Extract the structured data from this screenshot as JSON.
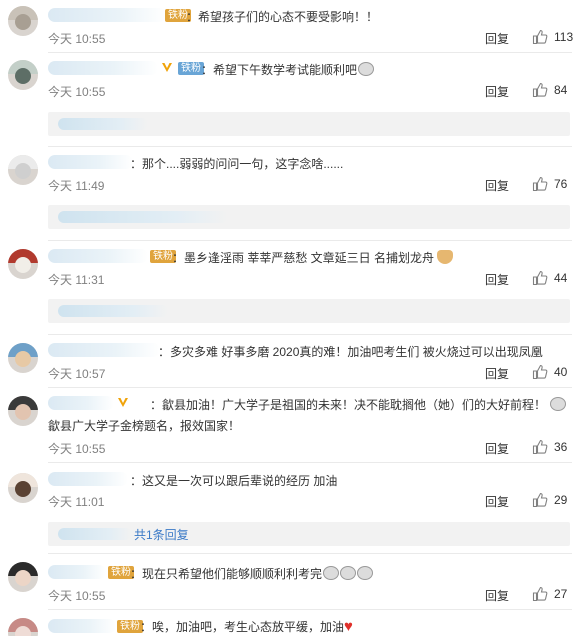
{
  "actions": {
    "reply_label": "回复"
  },
  "comments": [
    {
      "badge": "铁粉",
      "text": "：希望孩子们的心态不要受影响！！",
      "time": "今天 10:55",
      "likes": "113"
    },
    {
      "badge": "铁粉",
      "text": "：希望下午数学考试能顺利吧",
      "time": "今天 10:55",
      "likes": "84"
    },
    {
      "text": "：那个....弱弱的问问一句，这字念啥......",
      "time": "今天 11:49",
      "likes": "76"
    },
    {
      "badge": "铁粉",
      "text": "：墨乡逢淫雨 莘莘严慈愁 文章延三日 名捕划龙舟",
      "time": "今天 11:31",
      "likes": "44"
    },
    {
      "text": "：多灾多难 好事多磨 2020真的难！加油吧考生们 被火烧过可以出现凤凰",
      "time": "今天 10:57",
      "likes": "40"
    },
    {
      "text": "：歙县加油！广大学子是祖国的未来！决不能耽搁他（她）们的大好前程！",
      "text2": "歙县广大学子金榜题名，报效国家！",
      "time": "今天 10:55",
      "likes": "36"
    },
    {
      "text": "：这又是一次可以跟后辈说的经历 加油",
      "time": "今天 11:01",
      "likes": "29",
      "sub_reply": "共1条回复"
    },
    {
      "badge": "铁粉",
      "text": "：现在只希望他们能够顺顺利利考完",
      "time": "今天 10:55",
      "likes": "27"
    },
    {
      "badge": "铁粉",
      "text": "：唉，加油吧，考生心态放平缓，加油"
    }
  ],
  "icons": {
    "like": "thumbs-up-icon",
    "vip": "verified-v-icon",
    "heart": "heart-emoji-icon",
    "cat": "cat-emoji-icon"
  },
  "colors": {
    "link": "#3b7ac7",
    "badge_tie": "#e0a43c",
    "badge_fan": "#69a5d6",
    "heart": "#e0302a"
  }
}
